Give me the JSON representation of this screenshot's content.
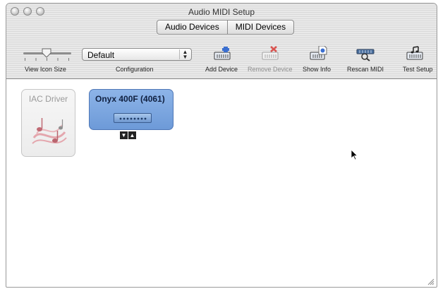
{
  "window": {
    "title": "Audio MIDI Setup"
  },
  "tabs": [
    {
      "label": "Audio Devices"
    },
    {
      "label": "MIDI Devices"
    }
  ],
  "toolbar": {
    "view_icon_size": {
      "label": "View Icon Size"
    },
    "configuration": {
      "label": "Configuration",
      "value": "Default"
    },
    "add_device": {
      "label": "Add Device"
    },
    "remove_device": {
      "label": "Remove Device",
      "enabled": false
    },
    "show_info": {
      "label": "Show Info"
    },
    "rescan_midi": {
      "label": "Rescan MIDI"
    },
    "test_setup": {
      "label": "Test Setup"
    }
  },
  "devices": [
    {
      "name": "IAC Driver",
      "icon": "music-notes-icon",
      "enabled": false
    },
    {
      "name": "Onyx 400F (4061)",
      "icon": "audio-interface-icon",
      "selected": true
    }
  ],
  "colors": {
    "selected_device": "#7aa3dd",
    "chrome": "#e4e4e4"
  }
}
